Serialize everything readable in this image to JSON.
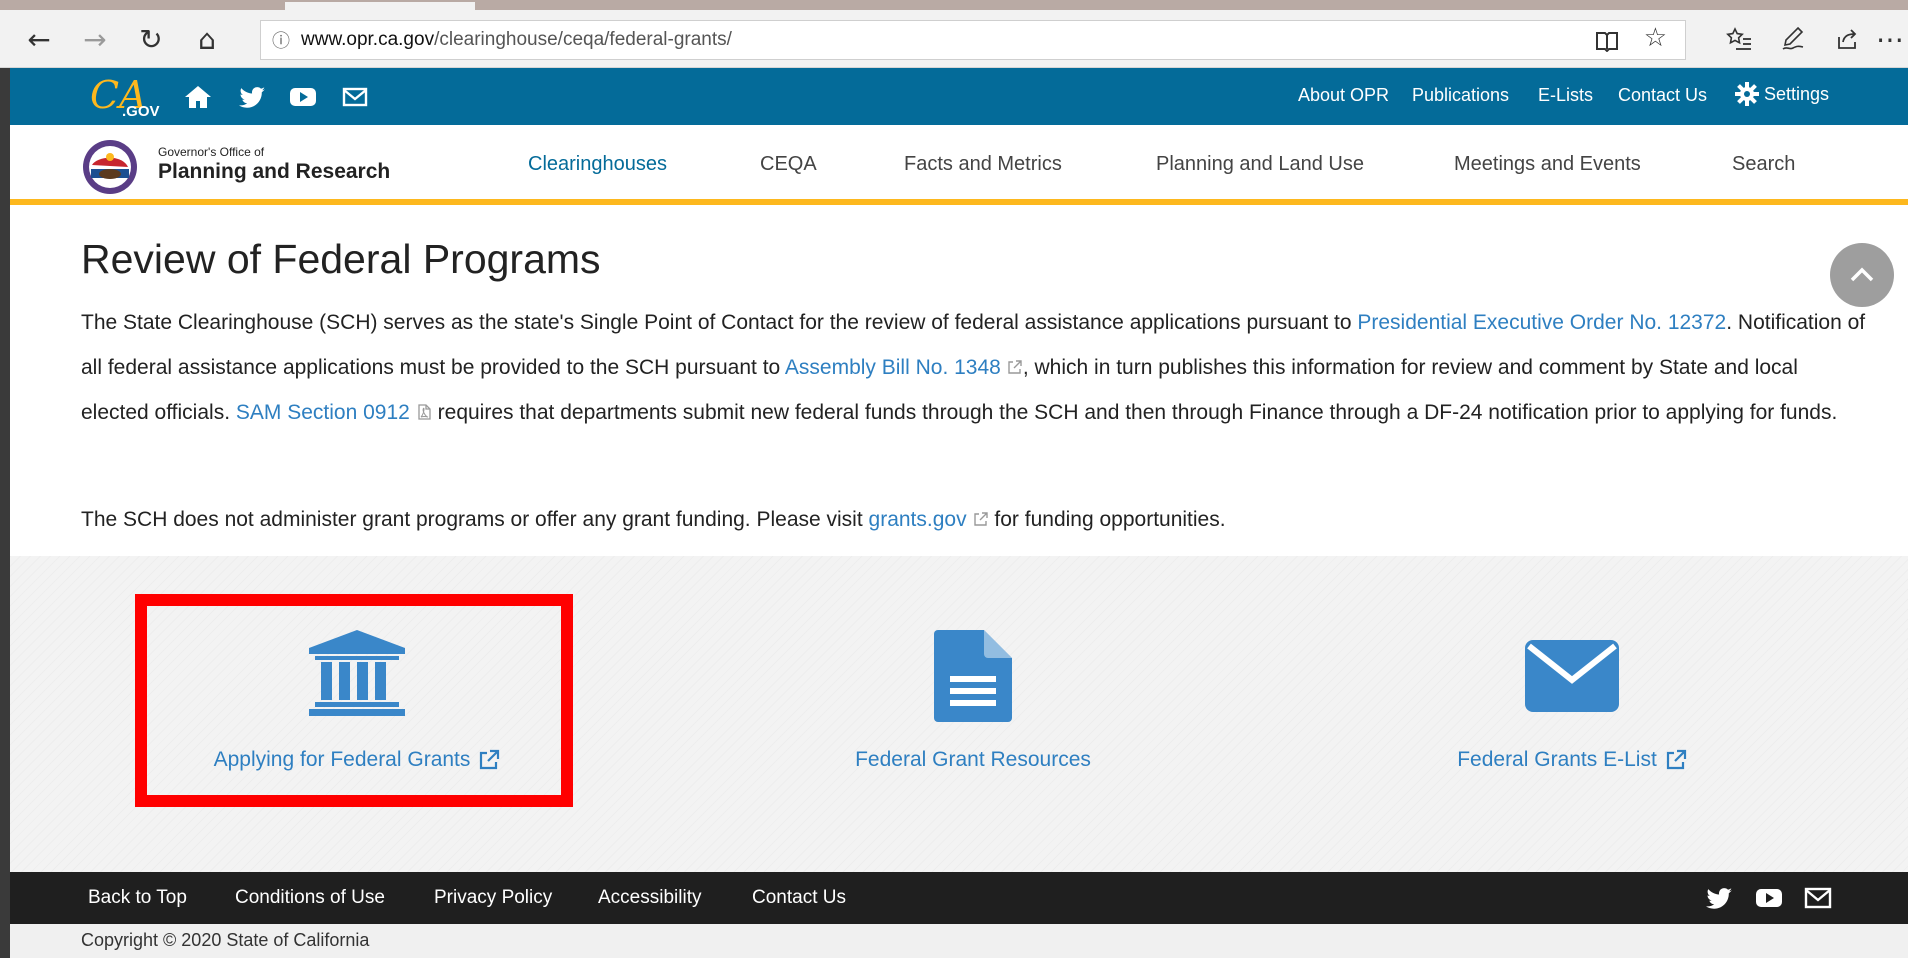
{
  "browser": {
    "url_host": "www.opr.ca.gov",
    "url_path": "/clearinghouse/ceqa/federal-grants/",
    "icons": [
      "back-icon",
      "forward-icon",
      "refresh-icon",
      "home-icon",
      "info-icon",
      "reading-view-icon",
      "favorite-star-icon",
      "favorites-list-icon",
      "pen-icon",
      "share-icon",
      "more-icon"
    ]
  },
  "utility_bar": {
    "logo_text": "CA.GOV",
    "links": [
      "About OPR",
      "Publications",
      "E-Lists",
      "Contact Us"
    ],
    "settings_label": "Settings",
    "icons": [
      "home-icon",
      "twitter-icon",
      "youtube-icon",
      "email-icon",
      "gear-icon"
    ]
  },
  "header": {
    "org_small": "Governor's Office of",
    "org_name": "Planning and Research",
    "nav": [
      "Clearinghouses",
      "CEQA",
      "Facts and Metrics",
      "Planning and Land Use",
      "Meetings and Events",
      "Search"
    ],
    "active_nav": "Clearinghouses"
  },
  "main": {
    "title": "Review of Federal Programs",
    "para1": {
      "t1": "The State Clearinghouse (SCH) serves as the state's Single Point of Contact for the review of federal assistance applications pursuant to ",
      "link1": "Presidential Executive Order No. 12372",
      "t2": ". Notification of all federal assistance applications must be provided to the SCH pursuant to ",
      "link2": "Assembly Bill No. 1348",
      "t3": ", which in turn publishes this information for review and comment by State and local elected officials. ",
      "link3": "SAM Section 0912",
      "t4": " requires that departments submit new federal funds through the SCH and then through Finance through a DF-24 notification prior to applying for funds."
    },
    "para2": {
      "t1": "The SCH does not administer grant programs or offer any grant funding. Please visit ",
      "link1": "grants.gov",
      "t2": " for funding opportunities."
    }
  },
  "cards": [
    {
      "label": "Applying for Federal Grants",
      "icon": "bank-icon",
      "external": true
    },
    {
      "label": "Federal Grant Resources",
      "icon": "document-icon",
      "external": false
    },
    {
      "label": "Federal Grants E-List",
      "icon": "envelope-icon",
      "external": true
    }
  ],
  "footer": {
    "links": [
      "Back to Top",
      "Conditions of Use",
      "Privacy Policy",
      "Accessibility",
      "Contact Us"
    ],
    "icons": [
      "twitter-icon",
      "youtube-icon",
      "email-icon"
    ],
    "copyright": "Copyright © 2020 State of California"
  },
  "colors": {
    "util_bar": "#046b99",
    "accent_yellow": "#fdb81e",
    "link": "#2e7fc1",
    "icon_blue": "#3a87c9",
    "footer": "#1f1f1f",
    "highlight": "#ff0000"
  }
}
